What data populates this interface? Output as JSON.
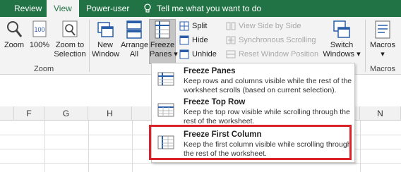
{
  "tabs": {
    "review": "Review",
    "view": "View",
    "power_user": "Power-user",
    "tell_me": "Tell me what you want to do"
  },
  "ribbon": {
    "zoom": "Zoom",
    "zoom_100": "100%",
    "zoom_selection_line1": "Zoom to",
    "zoom_selection_line2": "Selection",
    "zoom_group": "Zoom",
    "new_window_line1": "New",
    "new_window_line2": "Window",
    "arrange_all_line1": "Arrange",
    "arrange_all_line2": "All",
    "freeze_panes_line1": "Freeze",
    "freeze_panes_line2": "Panes ▾",
    "split": "Split",
    "hide": "Hide",
    "unhide": "Unhide",
    "view_side_by_side": "View Side by Side",
    "synchronous_scrolling": "Synchronous Scrolling",
    "reset_window_position": "Reset Window Position",
    "switch_windows_line1": "Switch",
    "switch_windows_line2": "Windows ▾",
    "macros_line1": "Macros",
    "macros_line2": "▾",
    "macros_group": "Macros"
  },
  "columns": [
    "F",
    "G",
    "H",
    "N"
  ],
  "menu": {
    "items": [
      {
        "title": "Freeze Panes",
        "desc": "Keep rows and columns visible while the rest of the worksheet scrolls (based on current selection)."
      },
      {
        "title": "Freeze Top Row",
        "desc": "Keep the top row visible while scrolling through the rest of the worksheet."
      },
      {
        "title": "Freeze First Column",
        "desc": "Keep the first column visible while scrolling through the rest of the worksheet."
      }
    ]
  },
  "colors": {
    "accent": "#217346",
    "highlight": "#d9222a"
  }
}
